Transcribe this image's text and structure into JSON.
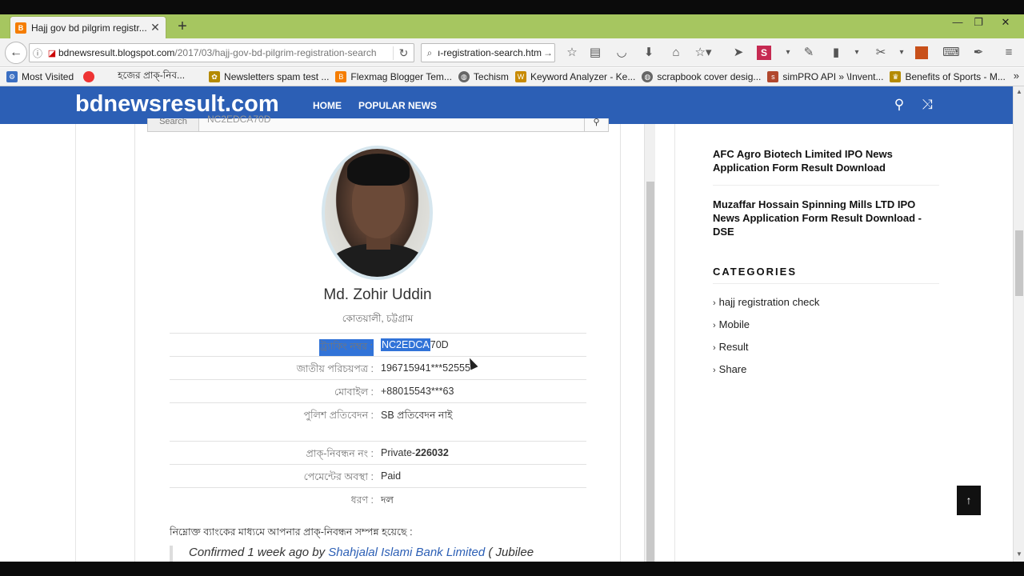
{
  "browser": {
    "tab_title": "Hajj gov bd pilgrim registr...",
    "tab_favicon": "B",
    "url_host": "bdnewsresult.blogspot.com",
    "url_path": "/2017/03/hajj-gov-bd-pilgrim-registration-search",
    "search_value": "ı-registration-search.html",
    "bookmarks": [
      {
        "label": "Most Visited",
        "icon": "gear-icon",
        "color": "#3b6fc2"
      },
      {
        "label": "",
        "icon": "red-bug-icon",
        "color": "#e33"
      },
      {
        "label": "হজের প্রাক্-নিব...",
        "icon": "",
        "color": ""
      },
      {
        "label": "Newsletters spam test ...",
        "icon": "leaf-icon",
        "color": "#b48a00"
      },
      {
        "label": "Flexmag Blogger Tem...",
        "icon": "blogger-icon",
        "color": "#f57d00"
      },
      {
        "label": "Techism",
        "icon": "globe-icon",
        "color": "#666"
      },
      {
        "label": "Keyword Analyzer - Ke...",
        "icon": "ws-icon",
        "color": "#c88a00"
      },
      {
        "label": "scrapbook cover desig...",
        "icon": "globe-icon",
        "color": "#666"
      },
      {
        "label": "simPRO API » \\Invent...",
        "icon": "simpro-icon",
        "color": "#b1482e"
      },
      {
        "label": "Benefits of Sports - M...",
        "icon": "trophy-icon",
        "color": "#b48a00"
      }
    ],
    "bookmarks_more": "»"
  },
  "site": {
    "logo": "bdnewsresult.com",
    "nav": [
      "HOME",
      "POPULAR NEWS"
    ],
    "search_label": "Search",
    "search_value": "NC2EDCA70D"
  },
  "profile": {
    "name": "Md. Zohir Uddin",
    "location": "কোতয়ালী, চট্টগ্রাম",
    "rows": [
      {
        "label": "ট্র্যাকিং নম্বর :",
        "value_hl": "NC2EDCA",
        "value_rest": "70D"
      },
      {
        "label": "জাতীয় পরিচয়পত্র :",
        "value": "196715941***52555"
      },
      {
        "label": "মোবাইল :",
        "value": "+88015543***63"
      },
      {
        "label": "পুলিশ প্রতিবেদন :",
        "value": "SB প্রতিবেদন নাই"
      },
      {
        "label": "প্রাক্-নিবন্ধন নং :",
        "value_pre": "Private-",
        "value_bold": "226032"
      },
      {
        "label": "পেমেন্টের অবস্থা :",
        "value": "Paid"
      },
      {
        "label": "ধরণ :",
        "value": "দল"
      }
    ],
    "bank_note": "নিম্নোক্ত ব্যাংকের মাধ্যমে আপনার প্রাক্-নিবন্ধন সম্পন্ন হয়েছে :",
    "confirmed_prefix": "Confirmed 1 week ago by ",
    "bank_link": "Shahjalal Islami Bank Limited",
    "confirmed_suffix": " ( Jubilee"
  },
  "sidebar": {
    "posts": [
      "AFC Agro Biotech Limited IPO News Application Form Result Download",
      "Muzaffar Hossain Spinning Mills LTD IPO News Application Form Result Download - DSE"
    ],
    "categories_title": "CATEGORIES",
    "categories": [
      "hajj registration check",
      "Mobile",
      "Result",
      "Share"
    ]
  }
}
